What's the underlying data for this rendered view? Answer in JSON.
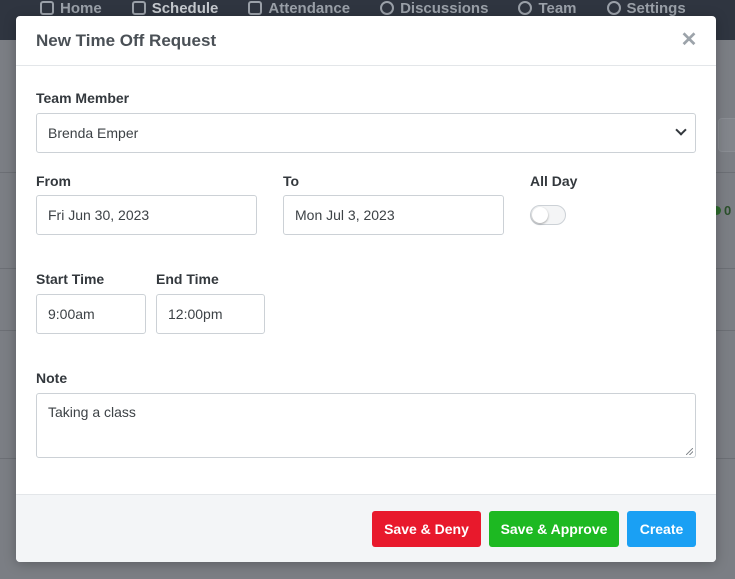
{
  "background_nav": {
    "items": [
      "Home",
      "Schedule",
      "Attendance",
      "Discussions",
      "Team",
      "Settings"
    ]
  },
  "background": {
    "status_text": "0"
  },
  "modal": {
    "title": "New Time Off Request",
    "close_icon": "close-icon",
    "team_member": {
      "label": "Team Member",
      "value": "Brenda Emper"
    },
    "from": {
      "label": "From",
      "value": "Fri Jun 30, 2023"
    },
    "to": {
      "label": "To",
      "value": "Mon Jul 3, 2023"
    },
    "all_day": {
      "label": "All Day",
      "checked": false
    },
    "start_time": {
      "label": "Start Time",
      "value": "9:00am"
    },
    "end_time": {
      "label": "End Time",
      "value": "12:00pm"
    },
    "note": {
      "label": "Note",
      "value": "Taking a class"
    },
    "buttons": {
      "deny": "Save & Deny",
      "approve": "Save & Approve",
      "create": "Create"
    }
  },
  "colors": {
    "deny": "#e8192c",
    "approve": "#1db922",
    "create": "#1aa0f4"
  }
}
